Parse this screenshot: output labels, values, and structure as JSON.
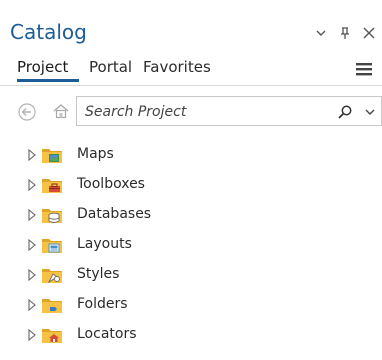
{
  "panel": {
    "title": "Catalog",
    "tabs": [
      {
        "label": "Project",
        "active": true
      },
      {
        "label": "Portal",
        "active": false
      },
      {
        "label": "Favorites",
        "active": false
      }
    ]
  },
  "search": {
    "placeholder": "Search Project"
  },
  "tree": {
    "items": [
      {
        "label": "Maps",
        "icon": "maps-folder-icon"
      },
      {
        "label": "Toolboxes",
        "icon": "toolboxes-folder-icon"
      },
      {
        "label": "Databases",
        "icon": "databases-folder-icon"
      },
      {
        "label": "Layouts",
        "icon": "layouts-folder-icon"
      },
      {
        "label": "Styles",
        "icon": "styles-folder-icon"
      },
      {
        "label": "Folders",
        "icon": "folders-folder-icon"
      },
      {
        "label": "Locators",
        "icon": "locators-folder-icon"
      }
    ]
  },
  "colors": {
    "accent": "#1d5d97",
    "folder": "#f5c243",
    "folder_dark": "#e0a526"
  }
}
